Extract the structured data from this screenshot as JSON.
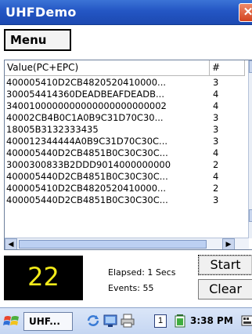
{
  "window": {
    "title": "UHFDemo",
    "close_glyph": "✕"
  },
  "menubar": {
    "menu_label": "Menu"
  },
  "list": {
    "columns": [
      "Value(PC+EPC)",
      "#"
    ],
    "rows": [
      {
        "epc": "400005410D2CB4820520410000...",
        "count": "3"
      },
      {
        "epc": "300054414360DEADBEAFDEADB...",
        "count": "4"
      },
      {
        "epc": "3400100000000000000000000002",
        "count": "4"
      },
      {
        "epc": "40002CB4B0C1A0B9C31D70C30...",
        "count": "3"
      },
      {
        "epc": "18005B3132333435",
        "count": "3"
      },
      {
        "epc": "400012344444A0B9C31D70C30C...",
        "count": "3"
      },
      {
        "epc": "400005440D2CB4851B0C30C30C...",
        "count": "4"
      },
      {
        "epc": "3000300833B2DDD9014000000000",
        "count": "2"
      },
      {
        "epc": "400005440D2CB4851B0C30C30C...",
        "count": "4"
      },
      {
        "epc": "400005410D2CB4820520410000...",
        "count": "2"
      },
      {
        "epc": "400005440D2CB4851B0C30C30C...",
        "count": "3"
      }
    ]
  },
  "status": {
    "counter": "22",
    "elapsed": "Elapsed: 1 Secs",
    "events": "Events: 55"
  },
  "buttons": {
    "start": "Start",
    "clear": "Clear"
  },
  "taskbar": {
    "task_label": "UHF...",
    "badge": "1",
    "clock": "3:38 PM"
  },
  "colors": {
    "titlebar": "#2456c4",
    "counter_text": "#f2ea1a",
    "counter_bg": "#000000"
  },
  "icons": {
    "start": "windows-flag-icon",
    "tray": [
      "sync-icon",
      "network-icon",
      "printer-icon",
      "battery-icon",
      "keyboard-icon"
    ]
  }
}
